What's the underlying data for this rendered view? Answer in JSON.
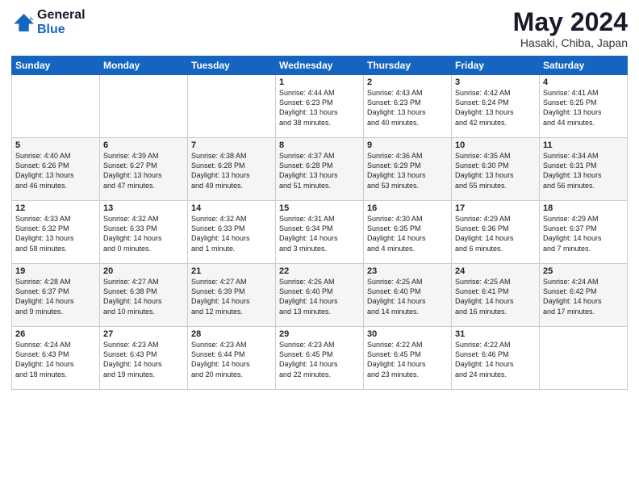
{
  "header": {
    "logo_line1": "General",
    "logo_line2": "Blue",
    "month_year": "May 2024",
    "location": "Hasaki, Chiba, Japan"
  },
  "weekdays": [
    "Sunday",
    "Monday",
    "Tuesday",
    "Wednesday",
    "Thursday",
    "Friday",
    "Saturday"
  ],
  "weeks": [
    [
      {
        "day": "",
        "info": ""
      },
      {
        "day": "",
        "info": ""
      },
      {
        "day": "",
        "info": ""
      },
      {
        "day": "1",
        "info": "Sunrise: 4:44 AM\nSunset: 6:23 PM\nDaylight: 13 hours\nand 38 minutes."
      },
      {
        "day": "2",
        "info": "Sunrise: 4:43 AM\nSunset: 6:23 PM\nDaylight: 13 hours\nand 40 minutes."
      },
      {
        "day": "3",
        "info": "Sunrise: 4:42 AM\nSunset: 6:24 PM\nDaylight: 13 hours\nand 42 minutes."
      },
      {
        "day": "4",
        "info": "Sunrise: 4:41 AM\nSunset: 6:25 PM\nDaylight: 13 hours\nand 44 minutes."
      }
    ],
    [
      {
        "day": "5",
        "info": "Sunrise: 4:40 AM\nSunset: 6:26 PM\nDaylight: 13 hours\nand 46 minutes."
      },
      {
        "day": "6",
        "info": "Sunrise: 4:39 AM\nSunset: 6:27 PM\nDaylight: 13 hours\nand 47 minutes."
      },
      {
        "day": "7",
        "info": "Sunrise: 4:38 AM\nSunset: 6:28 PM\nDaylight: 13 hours\nand 49 minutes."
      },
      {
        "day": "8",
        "info": "Sunrise: 4:37 AM\nSunset: 6:28 PM\nDaylight: 13 hours\nand 51 minutes."
      },
      {
        "day": "9",
        "info": "Sunrise: 4:36 AM\nSunset: 6:29 PM\nDaylight: 13 hours\nand 53 minutes."
      },
      {
        "day": "10",
        "info": "Sunrise: 4:35 AM\nSunset: 6:30 PM\nDaylight: 13 hours\nand 55 minutes."
      },
      {
        "day": "11",
        "info": "Sunrise: 4:34 AM\nSunset: 6:31 PM\nDaylight: 13 hours\nand 56 minutes."
      }
    ],
    [
      {
        "day": "12",
        "info": "Sunrise: 4:33 AM\nSunset: 6:32 PM\nDaylight: 13 hours\nand 58 minutes."
      },
      {
        "day": "13",
        "info": "Sunrise: 4:32 AM\nSunset: 6:33 PM\nDaylight: 14 hours\nand 0 minutes."
      },
      {
        "day": "14",
        "info": "Sunrise: 4:32 AM\nSunset: 6:33 PM\nDaylight: 14 hours\nand 1 minute."
      },
      {
        "day": "15",
        "info": "Sunrise: 4:31 AM\nSunset: 6:34 PM\nDaylight: 14 hours\nand 3 minutes."
      },
      {
        "day": "16",
        "info": "Sunrise: 4:30 AM\nSunset: 6:35 PM\nDaylight: 14 hours\nand 4 minutes."
      },
      {
        "day": "17",
        "info": "Sunrise: 4:29 AM\nSunset: 6:36 PM\nDaylight: 14 hours\nand 6 minutes."
      },
      {
        "day": "18",
        "info": "Sunrise: 4:29 AM\nSunset: 6:37 PM\nDaylight: 14 hours\nand 7 minutes."
      }
    ],
    [
      {
        "day": "19",
        "info": "Sunrise: 4:28 AM\nSunset: 6:37 PM\nDaylight: 14 hours\nand 9 minutes."
      },
      {
        "day": "20",
        "info": "Sunrise: 4:27 AM\nSunset: 6:38 PM\nDaylight: 14 hours\nand 10 minutes."
      },
      {
        "day": "21",
        "info": "Sunrise: 4:27 AM\nSunset: 6:39 PM\nDaylight: 14 hours\nand 12 minutes."
      },
      {
        "day": "22",
        "info": "Sunrise: 4:26 AM\nSunset: 6:40 PM\nDaylight: 14 hours\nand 13 minutes."
      },
      {
        "day": "23",
        "info": "Sunrise: 4:25 AM\nSunset: 6:40 PM\nDaylight: 14 hours\nand 14 minutes."
      },
      {
        "day": "24",
        "info": "Sunrise: 4:25 AM\nSunset: 6:41 PM\nDaylight: 14 hours\nand 16 minutes."
      },
      {
        "day": "25",
        "info": "Sunrise: 4:24 AM\nSunset: 6:42 PM\nDaylight: 14 hours\nand 17 minutes."
      }
    ],
    [
      {
        "day": "26",
        "info": "Sunrise: 4:24 AM\nSunset: 6:43 PM\nDaylight: 14 hours\nand 18 minutes."
      },
      {
        "day": "27",
        "info": "Sunrise: 4:23 AM\nSunset: 6:43 PM\nDaylight: 14 hours\nand 19 minutes."
      },
      {
        "day": "28",
        "info": "Sunrise: 4:23 AM\nSunset: 6:44 PM\nDaylight: 14 hours\nand 20 minutes."
      },
      {
        "day": "29",
        "info": "Sunrise: 4:23 AM\nSunset: 6:45 PM\nDaylight: 14 hours\nand 22 minutes."
      },
      {
        "day": "30",
        "info": "Sunrise: 4:22 AM\nSunset: 6:45 PM\nDaylight: 14 hours\nand 23 minutes."
      },
      {
        "day": "31",
        "info": "Sunrise: 4:22 AM\nSunset: 6:46 PM\nDaylight: 14 hours\nand 24 minutes."
      },
      {
        "day": "",
        "info": ""
      }
    ]
  ]
}
